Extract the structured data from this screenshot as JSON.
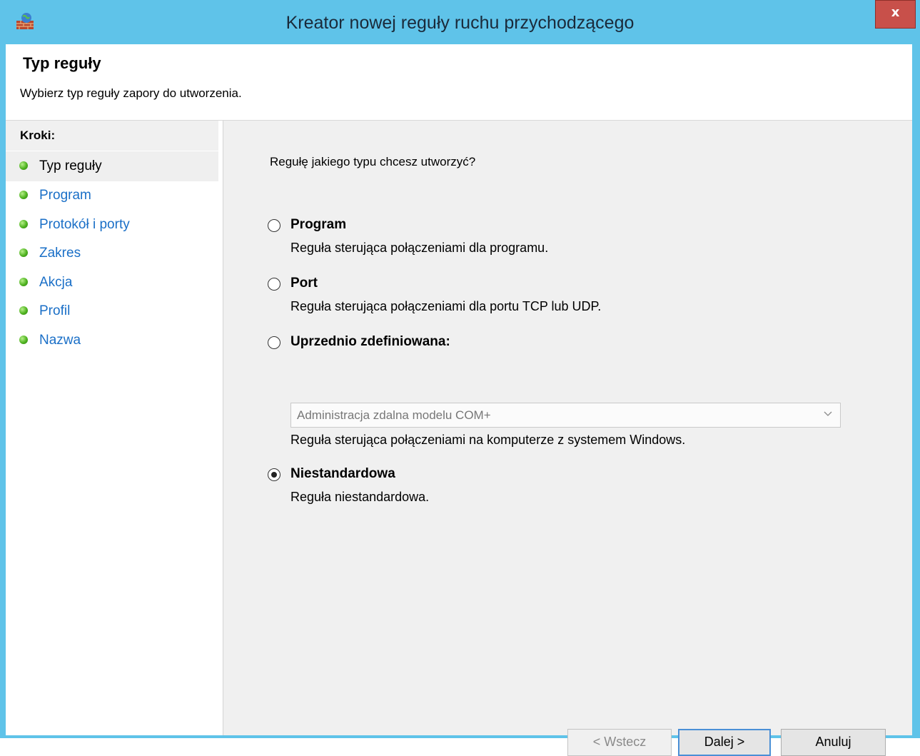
{
  "window": {
    "title": "Kreator nowej reguły ruchu przychodzącego",
    "close_label": "x",
    "icon": "firewall-icon"
  },
  "header": {
    "title": "Typ reguły",
    "subtitle": "Wybierz typ reguły zapory do utworzenia."
  },
  "steps": {
    "heading": "Kroki:",
    "items": [
      {
        "label": "Typ reguły",
        "active": true
      },
      {
        "label": "Program",
        "active": false
      },
      {
        "label": "Protokół i porty",
        "active": false
      },
      {
        "label": "Zakres",
        "active": false
      },
      {
        "label": "Akcja",
        "active": false
      },
      {
        "label": "Profil",
        "active": false
      },
      {
        "label": "Nazwa",
        "active": false
      }
    ]
  },
  "main": {
    "question": "Regułę jakiego typu chcesz utworzyć?",
    "options": [
      {
        "label": "Program",
        "description": "Reguła sterująca połączeniami dla programu.",
        "checked": false
      },
      {
        "label": "Port",
        "description": "Reguła sterująca połączeniami dla portu TCP lub UDP.",
        "checked": false
      },
      {
        "label": "Uprzednio zdefiniowana:",
        "description": "Reguła sterująca połączeniami na komputerze z systemem Windows.",
        "checked": false
      },
      {
        "label": "Niestandardowa",
        "description": "Reguła niestandardowa.",
        "checked": true
      }
    ],
    "predefined_select": {
      "value": "Administracja zdalna modelu COM+",
      "disabled": true
    }
  },
  "buttons": {
    "back": "< Wstecz",
    "next": "Dalej >",
    "cancel": "Anuluj"
  }
}
